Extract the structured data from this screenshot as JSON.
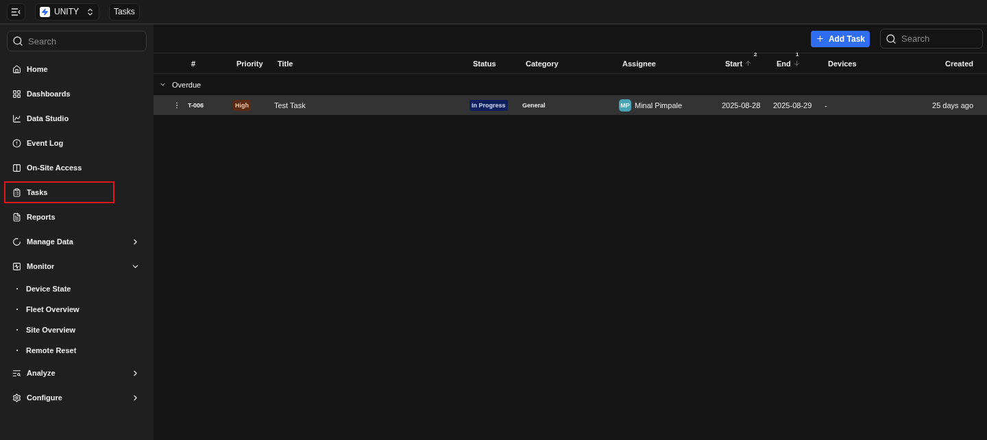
{
  "topbar": {
    "org": "UNITY",
    "breadcrumb": "Tasks"
  },
  "sidebar": {
    "search_placeholder": "Search",
    "items": [
      {
        "label": "Home",
        "kind": "link",
        "selected": false
      },
      {
        "label": "Dashboards",
        "kind": "link",
        "selected": false
      },
      {
        "label": "Data Studio",
        "kind": "link",
        "selected": false
      },
      {
        "label": "Event Log",
        "kind": "link",
        "selected": false
      },
      {
        "label": "On-Site Access",
        "kind": "link",
        "selected": false
      },
      {
        "label": "Tasks",
        "kind": "link",
        "selected": true
      },
      {
        "label": "Reports",
        "kind": "link",
        "selected": false
      },
      {
        "label": "Manage Data",
        "kind": "group",
        "expanded": false,
        "selected": false
      },
      {
        "label": "Monitor",
        "kind": "group",
        "expanded": true,
        "selected": false,
        "children": [
          {
            "label": "Device State"
          },
          {
            "label": "Fleet Overview"
          },
          {
            "label": "Site Overview"
          },
          {
            "label": "Remote Reset"
          }
        ]
      },
      {
        "label": "Analyze",
        "kind": "group",
        "expanded": false,
        "selected": false
      },
      {
        "label": "Configure",
        "kind": "group",
        "expanded": false,
        "selected": false
      }
    ]
  },
  "toolbar": {
    "add_button": "Add Task",
    "search_placeholder": "Search"
  },
  "table": {
    "columns": [
      {
        "label": "#"
      },
      {
        "label": "Priority"
      },
      {
        "label": "Title"
      },
      {
        "label": "Status"
      },
      {
        "label": "Category"
      },
      {
        "label": "Assignee"
      },
      {
        "label": "Start",
        "sort_descending": false,
        "sort_rank": "2"
      },
      {
        "label": "End",
        "sort_descending": true,
        "sort_rank": "1"
      },
      {
        "label": "Devices"
      },
      {
        "label": "Created"
      }
    ],
    "groups": [
      {
        "label": "Overdue",
        "expanded": true,
        "rows": [
          {
            "id": "T-006",
            "priority": "High",
            "title": "Test Task",
            "status": "In Progress",
            "category": "General",
            "assignee_initials": "MP",
            "assignee": "Minal Pimpale",
            "start": "2025-08-28",
            "end": "2025-08-29",
            "devices": "-",
            "created": "25 days ago"
          }
        ]
      }
    ]
  }
}
